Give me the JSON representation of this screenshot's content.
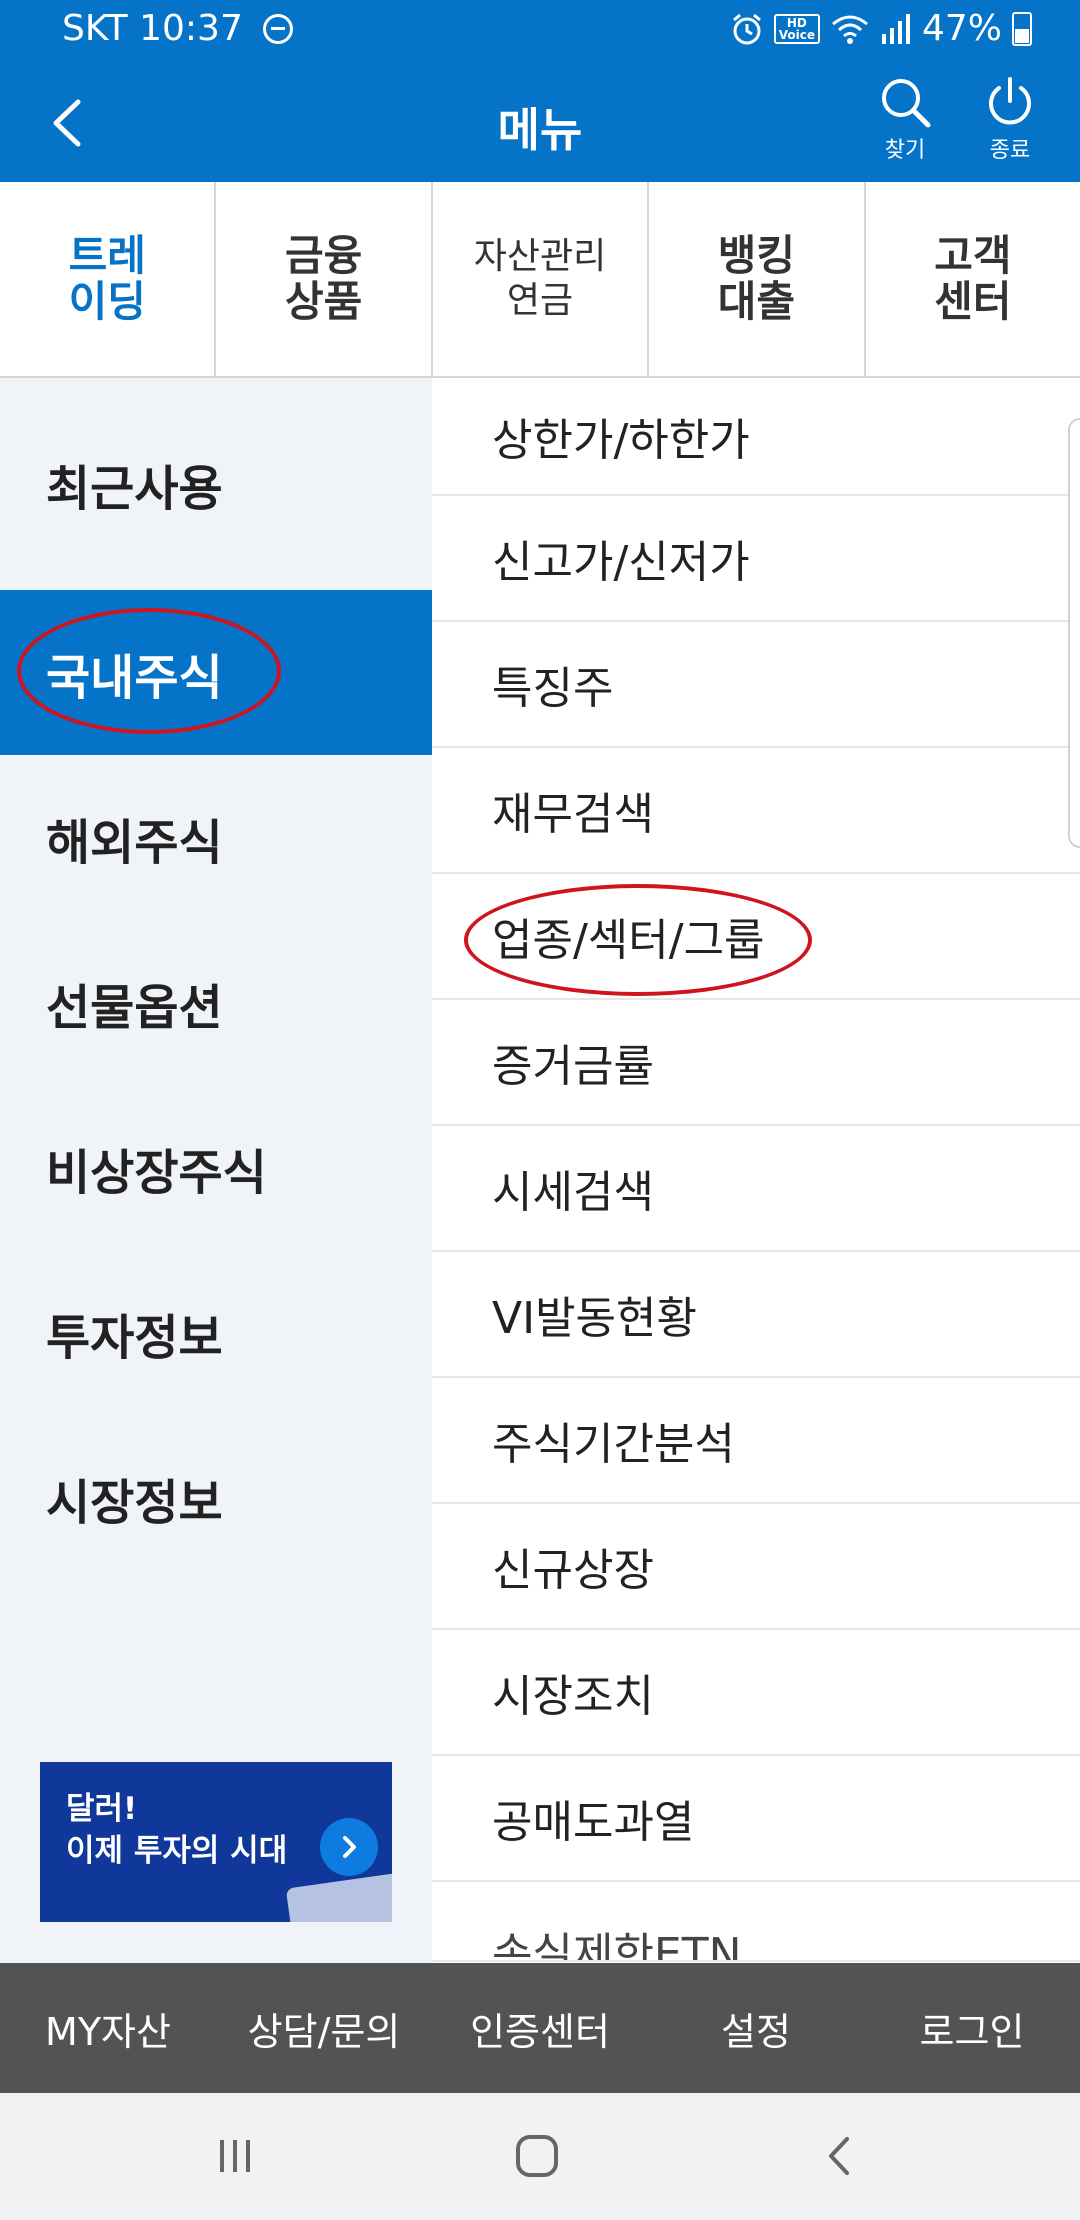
{
  "status": {
    "carrier_time": "SKT 10:37",
    "battery": "47%"
  },
  "header": {
    "title": "메뉴",
    "search_label": "찾기",
    "exit_label": "종료"
  },
  "top_categories": [
    {
      "label": "트레\n이딩",
      "active": true
    },
    {
      "label": "금융\n상품",
      "active": false
    },
    {
      "label": "자산관리\n연금",
      "active": false
    },
    {
      "label": "뱅킹\n대출",
      "active": false
    },
    {
      "label": "고객\n센터",
      "active": false
    }
  ],
  "left_menu": [
    {
      "label": "최근사용"
    },
    {
      "label": "국내주식",
      "active": true
    },
    {
      "label": "해외주식"
    },
    {
      "label": "선물옵션"
    },
    {
      "label": "비상장주식"
    },
    {
      "label": "투자정보"
    },
    {
      "label": "시장정보"
    }
  ],
  "banner": {
    "line1": "달러!",
    "line2": "이제 투자의 시대"
  },
  "right_menu": [
    {
      "label": "상한가/하한가"
    },
    {
      "label": "신고가/신저가"
    },
    {
      "label": "특징주"
    },
    {
      "label": "재무검색"
    },
    {
      "label": "업종/섹터/그룹",
      "circled": true
    },
    {
      "label": "증거금률"
    },
    {
      "label": "시세검색"
    },
    {
      "label": "VI발동현황"
    },
    {
      "label": "주식기간분석"
    },
    {
      "label": "신규상장"
    },
    {
      "label": "시장조치"
    },
    {
      "label": "공매도과열"
    },
    {
      "label": "손실제한ETN"
    }
  ],
  "bottom_bar": [
    {
      "label": "MY자산"
    },
    {
      "label": "상담/문의"
    },
    {
      "label": "인증센터"
    },
    {
      "label": "설정"
    },
    {
      "label": "로그인"
    }
  ],
  "colors": {
    "primary": "#0573c7",
    "annotation": "#d0141e",
    "bottom_bar": "#535353",
    "left_bg": "#f0f3f7"
  }
}
